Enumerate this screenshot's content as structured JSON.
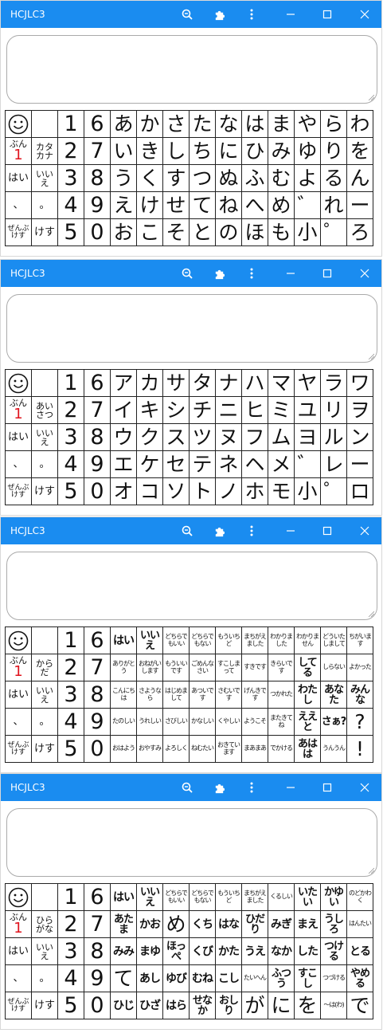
{
  "title": "HCJLC3",
  "icons": [
    "zoom-out-icon",
    "extensions-icon",
    "more-icon",
    "minimize-icon",
    "maximize-icon",
    "close-icon"
  ],
  "panels": [
    {
      "name": "hiragana",
      "rows": [
        [
          "☺",
          "",
          "1",
          "6",
          "あ",
          "か",
          "さ",
          "た",
          "な",
          "は",
          "ま",
          "や",
          "ら",
          "わ"
        ],
        [
          "ぶん1",
          "カタカナ",
          "2",
          "7",
          "い",
          "き",
          "し",
          "ち",
          "に",
          "ひ",
          "み",
          "ゆ",
          "り",
          "を"
        ],
        [
          "はい",
          "いいえ",
          "3",
          "8",
          "う",
          "く",
          "す",
          "つ",
          "ぬ",
          "ふ",
          "む",
          "よ",
          "る",
          "ん"
        ],
        [
          "、",
          "。",
          "4",
          "9",
          "え",
          "け",
          "せ",
          "て",
          "ね",
          "へ",
          "め",
          "゛",
          "れ",
          "ー"
        ],
        [
          "ぜんぶけす",
          "けす",
          "5",
          "0",
          "お",
          "こ",
          "そ",
          "と",
          "の",
          "ほ",
          "も",
          "小",
          "゜",
          "ろ"
        ]
      ]
    },
    {
      "name": "katakana",
      "rows": [
        [
          "☺",
          "",
          "1",
          "6",
          "ア",
          "カ",
          "サ",
          "タ",
          "ナ",
          "ハ",
          "マ",
          "ヤ",
          "ラ",
          "ワ"
        ],
        [
          "ぶん1",
          "あいさつ",
          "2",
          "7",
          "イ",
          "キ",
          "シ",
          "チ",
          "ニ",
          "ヒ",
          "ミ",
          "ユ",
          "リ",
          "ヲ"
        ],
        [
          "はい",
          "いいえ",
          "3",
          "8",
          "ウ",
          "ク",
          "ス",
          "ツ",
          "ヌ",
          "フ",
          "ム",
          "ヨ",
          "ル",
          "ン"
        ],
        [
          "、",
          "。",
          "4",
          "9",
          "エ",
          "ケ",
          "セ",
          "テ",
          "ネ",
          "ヘ",
          "メ",
          "゛",
          "レ",
          "ー"
        ],
        [
          "ぜんぶけす",
          "けす",
          "5",
          "0",
          "オ",
          "コ",
          "ソ",
          "ト",
          "ノ",
          "ホ",
          "モ",
          "小",
          "゜",
          "ロ"
        ]
      ]
    },
    {
      "name": "greetings",
      "rows": [
        [
          "☺",
          "",
          "1",
          "6",
          "はい",
          "いいえ",
          "どちらでもいい",
          "どちらでもない",
          "もういちど",
          "まちがえました",
          "わかりました",
          "わかりません",
          "どういたしまして",
          "ちがいます"
        ],
        [
          "ぶん1",
          "からだ",
          "2",
          "7",
          "ありがとう",
          "おねがいします",
          "もういいです",
          "ごめんなさい",
          "すこしまって",
          "すきです",
          "きらいです",
          "してる",
          "しらない",
          "よかった"
        ],
        [
          "はい",
          "いいえ",
          "3",
          "8",
          "こんにちは",
          "さようなら",
          "はじめまして",
          "あついです",
          "さむいです",
          "げんきです",
          "つかれた",
          "わたし",
          "あなた",
          "みんな"
        ],
        [
          "、",
          "。",
          "4",
          "9",
          "たのしい",
          "うれしい",
          "さびしい",
          "かなしい",
          "くやしい",
          "ようこそ",
          "またきてね",
          "ええと",
          "さぁ?",
          "?"
        ],
        [
          "ぜんぶけす",
          "けす",
          "5",
          "0",
          "おはよう",
          "おやすみ",
          "よろしく",
          "ねむたい",
          "おきています",
          "まあまあ",
          "でかける",
          "あはは",
          "うんうん",
          "!"
        ]
      ]
    },
    {
      "name": "body",
      "rows": [
        [
          "☺",
          "",
          "1",
          "6",
          "はい",
          "いいえ",
          "どちらでもいい",
          "どちらでもない",
          "もういちど",
          "まちがえました",
          "くるしい",
          "いたい",
          "かゆい",
          "のどかわく"
        ],
        [
          "ぶん1",
          "ひらがな",
          "2",
          "7",
          "あたま",
          "かお",
          "め",
          "くち",
          "はな",
          "ひだり",
          "みぎ",
          "まえ",
          "うしろ",
          "はんたい"
        ],
        [
          "はい",
          "いいえ",
          "3",
          "8",
          "みみ",
          "まゆ",
          "ほっぺ",
          "くび",
          "かた",
          "うえ",
          "なか",
          "した",
          "つける",
          "とる"
        ],
        [
          "、",
          "。",
          "4",
          "9",
          "て",
          "あし",
          "ゆび",
          "むね",
          "こし",
          "たいへん",
          "ふつう",
          "すこし",
          "つづける",
          "やめる"
        ],
        [
          "ぜんぶけす",
          "けす",
          "5",
          "0",
          "ひじ",
          "ひざ",
          "はら",
          "せなか",
          "おしり",
          "が",
          "に",
          "を",
          "〜は(わ)",
          "で"
        ]
      ]
    }
  ]
}
